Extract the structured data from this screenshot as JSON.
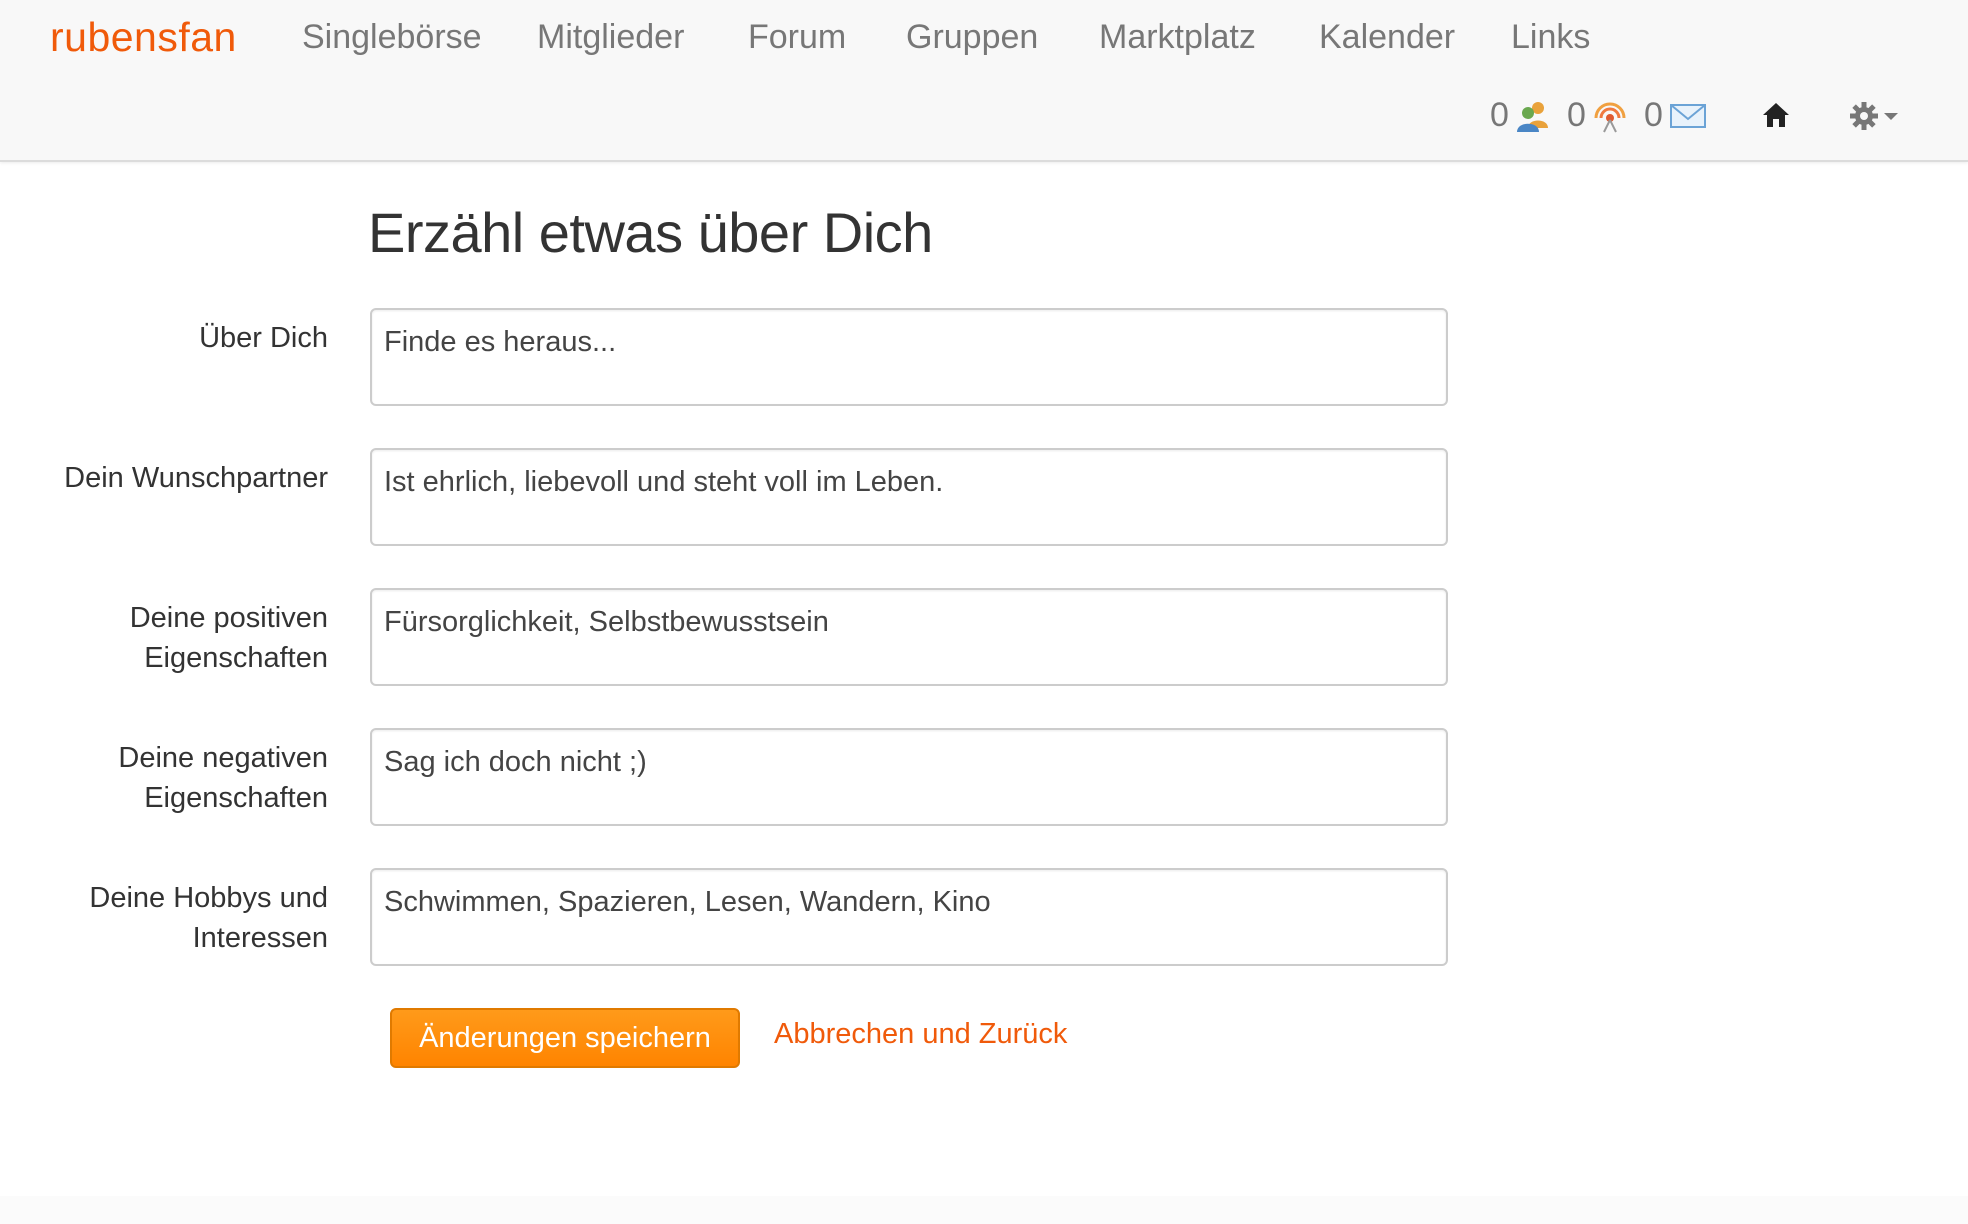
{
  "navbar": {
    "brand": "rubensfan",
    "links": [
      "Singlebörse",
      "Mitglieder",
      "Forum",
      "Gruppen",
      "Marktplatz",
      "Kalender",
      "Links"
    ],
    "counters": {
      "contacts": "0",
      "visits": "0",
      "messages": "0"
    },
    "icons": [
      "contacts-icon",
      "visitors-icon",
      "mail-icon",
      "home-icon",
      "gear-icon",
      "caret-down-icon"
    ]
  },
  "page": {
    "title": "Erzähl etwas über Dich"
  },
  "form": {
    "fields": [
      {
        "label": "Über Dich",
        "value": "Finde es heraus..."
      },
      {
        "label": "Dein Wunschpartner",
        "value": "Ist ehrlich, liebevoll und steht voll im Leben."
      },
      {
        "label": "Deine positiven Eigenschaften",
        "value": "Fürsorglichkeit, Selbstbewusstsein"
      },
      {
        "label": "Deine negativen Eigenschaften",
        "value": "Sag ich doch nicht ;)"
      },
      {
        "label": "Deine Hobbys und Interessen",
        "value": "Schwimmen, Spazieren, Lesen, Wandern, Kino"
      }
    ],
    "save_label": "Änderungen speichern",
    "cancel_label": "Abbrechen und Zurück"
  },
  "colors": {
    "brand": "#f05a0a",
    "button": "#ff8c00",
    "navbar_bg": "#f8f8f8"
  }
}
